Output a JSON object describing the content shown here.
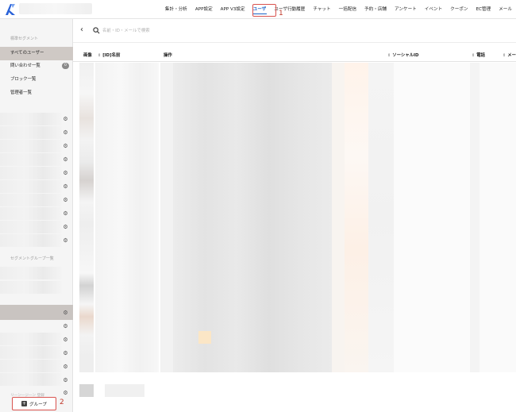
{
  "nav": {
    "items": [
      "集計・分析",
      "APP設定",
      "APP V3設定",
      "ユーザ",
      "ユーザ行動履歴",
      "チャット",
      "一括配信",
      "予約・店舗",
      "アンケート",
      "イベント",
      "クーポン",
      "EC管理",
      "メール"
    ],
    "active_index": 3
  },
  "annotations": {
    "first": "1",
    "second": "2"
  },
  "sidebar": {
    "section_basic": "標準セグメント",
    "items": [
      {
        "label": "すべてのユーザー",
        "active": true
      },
      {
        "label": "問い合わせ一覧",
        "badge": "0"
      },
      {
        "label": "ブロック一覧"
      },
      {
        "label": "管理者一覧"
      }
    ],
    "section_group": "セグメントグループ一覧",
    "footer_partial": "リ―ン―ジ―ン 登録",
    "add_group_label": "グループ"
  },
  "search": {
    "placeholder": "名前・ID・メールで検索"
  },
  "table": {
    "headers": [
      "画像",
      "[ID]名前",
      "操作",
      "ソーシャルID",
      "電話",
      "メー"
    ]
  },
  "colors": {
    "accent": "#1a63c7",
    "annotation": "#d9534f",
    "sidebar_active": "#cfc9c5"
  }
}
